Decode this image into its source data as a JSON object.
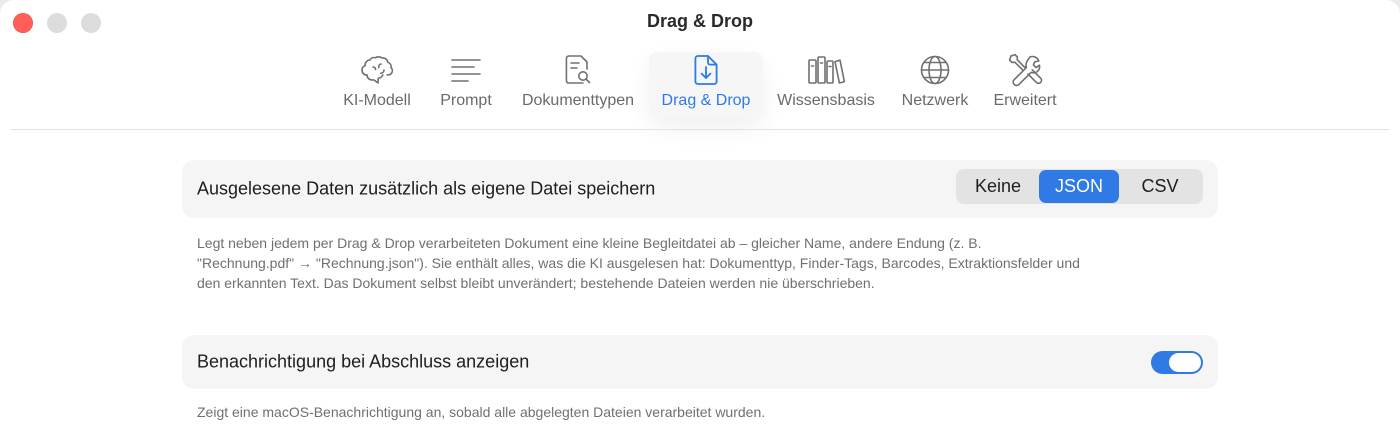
{
  "window": {
    "title": "Drag & Drop"
  },
  "toolbar": {
    "tabs": [
      {
        "label": "KI-Modell",
        "icon": "brain-icon",
        "active": false
      },
      {
        "label": "Prompt",
        "icon": "text-lines-icon",
        "active": false
      },
      {
        "label": "Dokumenttypen",
        "icon": "document-search-icon",
        "active": false
      },
      {
        "label": "Drag & Drop",
        "icon": "document-download-icon",
        "active": true
      },
      {
        "label": "Wissensbasis",
        "icon": "books-icon",
        "active": false
      },
      {
        "label": "Netzwerk",
        "icon": "globe-icon",
        "active": false
      },
      {
        "label": "Erweitert",
        "icon": "tools-icon",
        "active": false
      }
    ],
    "active_color": "#2f7ae5"
  },
  "settings": {
    "save_data": {
      "label": "Ausgelesene Daten zusätzlich als eigene Datei speichern",
      "options": [
        "Keine",
        "JSON",
        "CSV"
      ],
      "selected": "JSON",
      "description_lines": [
        "Legt neben jedem per Drag & Drop verarbeiteten Dokument eine kleine Begleitdatei ab – gleicher Name, andere Endung (z. B.",
        "\"Rechnung.pdf\" → \"Rechnung.json\"). Sie enthält alles, was die KI ausgelesen hat: Dokumenttyp, Finder-Tags, Barcodes, Extraktionsfelder und",
        "den erkannten Text. Das Dokument selbst bleibt unverändert; bestehende Dateien werden nie überschrieben."
      ]
    },
    "notification": {
      "label": "Benachrichtigung bei Abschluss anzeigen",
      "enabled": true,
      "description": "Zeigt eine macOS-Benachrichtigung an, sobald alle abgelegten Dateien verarbeitet wurden."
    }
  }
}
